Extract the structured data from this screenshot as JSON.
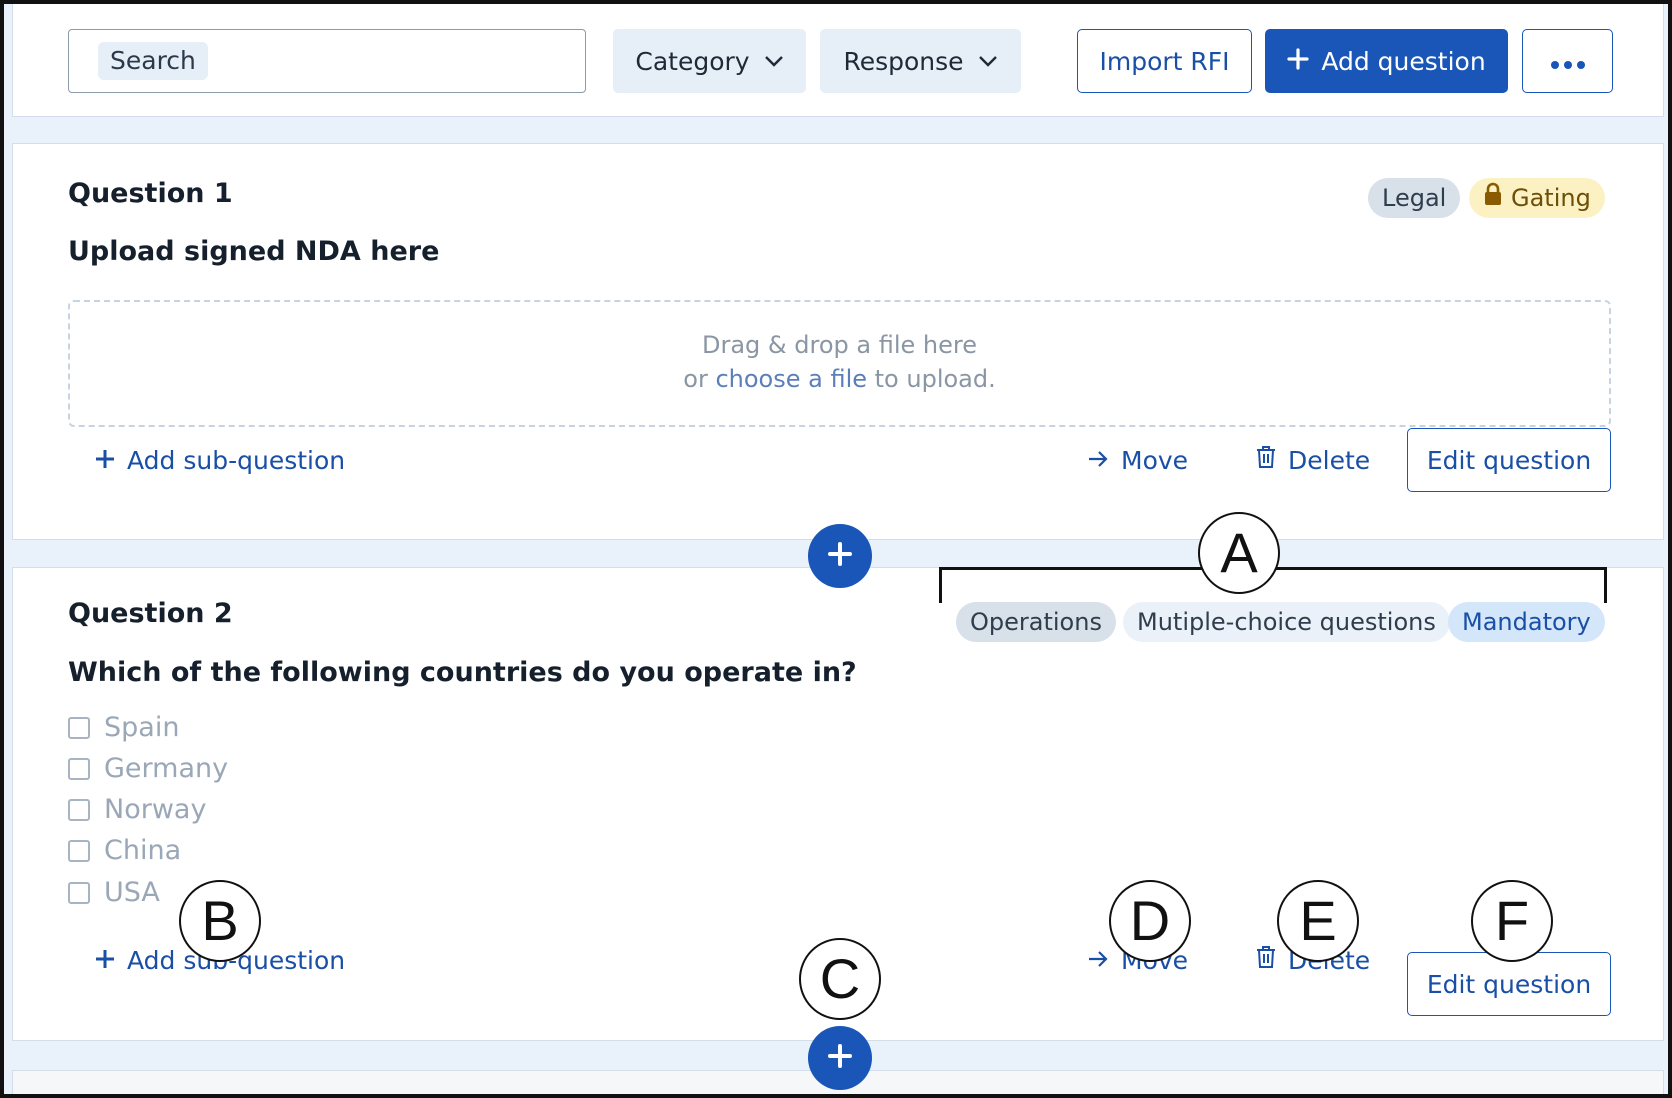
{
  "toolbar": {
    "search_placeholder": "Search",
    "category_label": "Category",
    "response_label": "Response",
    "import_label": "Import RFI",
    "add_question_label": "Add question",
    "more_label": "•••"
  },
  "questions": [
    {
      "title": "Question 1",
      "text": "Upload signed NDA here",
      "tags": [
        "Legal",
        "Gating"
      ],
      "dropzone": {
        "line1": "Drag & drop a file here",
        "line2_prefix": "or ",
        "line2_link": "choose a file",
        "line2_suffix": " to upload."
      },
      "actions": {
        "add_sub": "Add sub-question",
        "move": "Move",
        "delete": "Delete",
        "edit": "Edit question"
      }
    },
    {
      "title": "Question 2",
      "text": "Which of the following countries do you operate in?",
      "tags": [
        "Operations",
        "Mutiple-choice questions",
        "Mandatory"
      ],
      "options": [
        "Spain",
        "Germany",
        "Norway",
        "China",
        "USA"
      ],
      "actions": {
        "add_sub": "Add sub-question",
        "move": "Move",
        "delete": "Delete",
        "edit": "Edit question"
      }
    }
  ],
  "annotations": [
    "A",
    "B",
    "C",
    "D",
    "E",
    "F"
  ],
  "colors": {
    "primary": "#1a55b8",
    "background": "#e9f1fb",
    "gating": "#fbf1c3"
  }
}
